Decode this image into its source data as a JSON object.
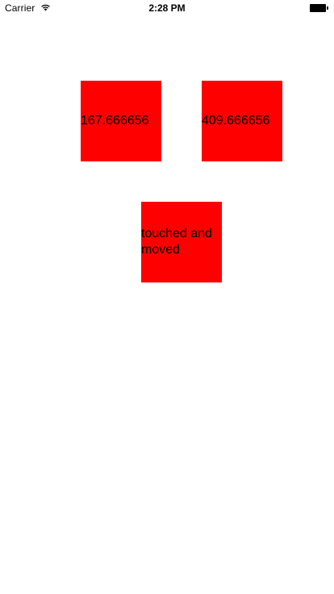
{
  "status_bar": {
    "carrier": "Carrier",
    "time": "2:28 PM",
    "wifi_icon": "wifi-icon",
    "battery_icon": "battery-icon"
  },
  "boxes": {
    "left": {
      "text": "167.666656",
      "color": "#ff0000"
    },
    "right": {
      "text": "409.666656",
      "color": "#ff0000"
    },
    "center": {
      "text": "touched and moved",
      "color": "#ff0000"
    }
  }
}
